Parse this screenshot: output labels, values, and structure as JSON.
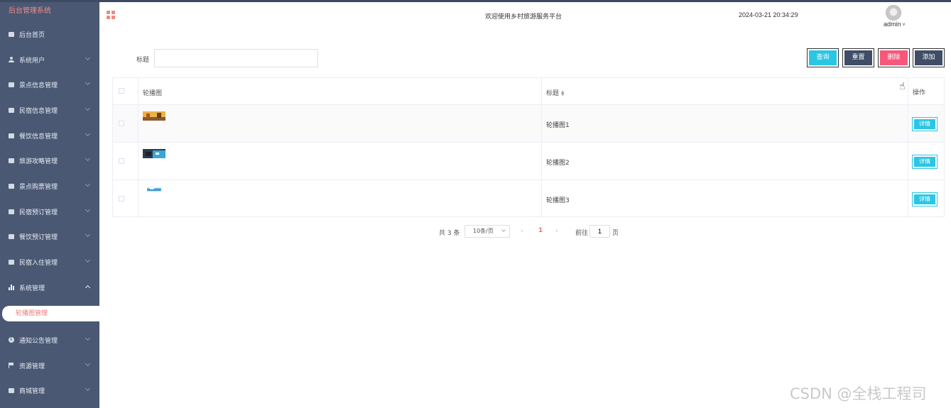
{
  "sidebar": {
    "brand": "后台管理系统",
    "items": [
      {
        "label": "后台首页",
        "icon": "monitor-icon"
      },
      {
        "label": "系统用户",
        "icon": "user-icon"
      },
      {
        "label": "景点信息管理",
        "icon": "list-icon"
      },
      {
        "label": "民宿信息管理",
        "icon": "list-icon"
      },
      {
        "label": "餐饮信息管理",
        "icon": "list-icon"
      },
      {
        "label": "旅游攻略管理",
        "icon": "list-icon"
      },
      {
        "label": "景点购票管理",
        "icon": "list-icon"
      },
      {
        "label": "民宿预订管理",
        "icon": "list-icon"
      },
      {
        "label": "餐饮预订管理",
        "icon": "list-icon"
      },
      {
        "label": "民宿入住管理",
        "icon": "list-icon"
      },
      {
        "label": "系统管理",
        "icon": "chart-icon"
      },
      {
        "label": "通知公告管理",
        "icon": "info-icon"
      },
      {
        "label": "资源管理",
        "icon": "flag-icon"
      },
      {
        "label": "商城管理",
        "icon": "monitor-icon"
      }
    ],
    "active_sub": "轮播图管理"
  },
  "header": {
    "welcome": "欢迎使用乡村旅游服务平台",
    "datetime": "2024-03-21 20:34:29",
    "user": "admin"
  },
  "search": {
    "label": "标题",
    "value": "",
    "placeholder": ""
  },
  "toolbar": {
    "query": "查询",
    "reset": "重置",
    "delete": "删除",
    "add": "添加"
  },
  "table": {
    "columns": [
      "轮播图",
      "标题",
      "操作"
    ],
    "rows": [
      {
        "title": "轮播图1",
        "action": "详情"
      },
      {
        "title": "轮播图2",
        "action": "详情"
      },
      {
        "title": "轮播图3",
        "action": "详情"
      }
    ]
  },
  "pagination": {
    "total": "共 3 条",
    "page_size": "10条/页",
    "current": "1",
    "prev": "‹",
    "next": "›",
    "goto": "前往",
    "goto_value": "1",
    "page_suffix": "页"
  },
  "watermark": "CSDN @全栈工程司",
  "colors": {
    "sidebar_bg": "#4a5873",
    "accent_cyan": "#2bc6e4",
    "accent_red": "#f5587a",
    "dark_btn": "#3f4d66",
    "active_text": "#f07878"
  }
}
